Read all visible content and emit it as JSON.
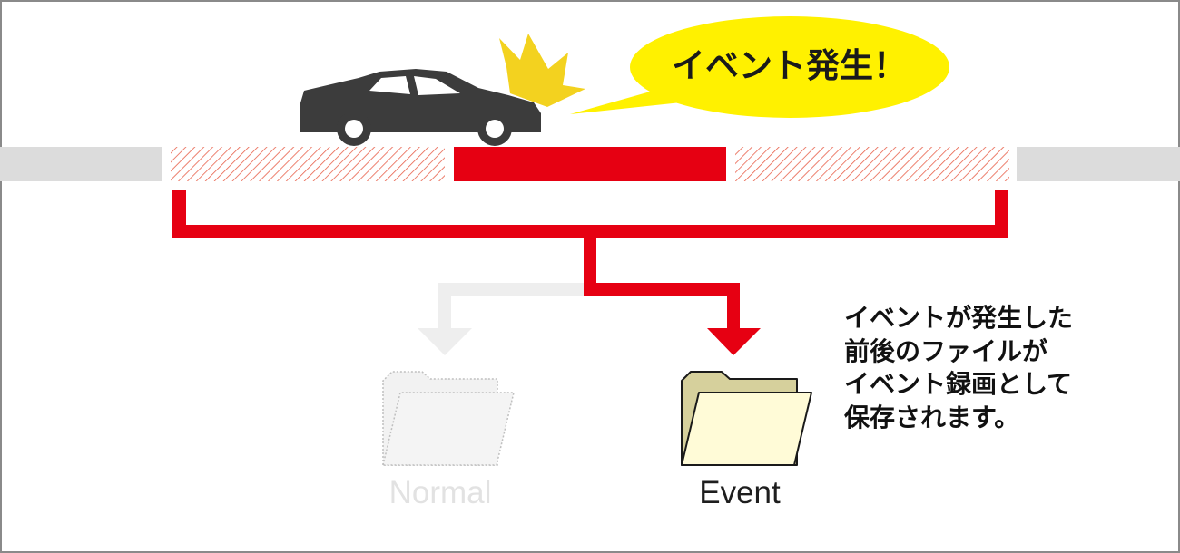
{
  "bubble": {
    "text": "イベント発生！"
  },
  "description": {
    "lines": [
      "イベントが発生した",
      "前後のファイルが",
      "イベント録画として",
      "保存されます。"
    ]
  },
  "folders": {
    "normal": {
      "label": "Normal",
      "icon": "folder-icon-faded"
    },
    "event": {
      "label": "Event",
      "icon": "folder-icon"
    }
  },
  "colors": {
    "accent_red": "#e60012",
    "track_gray": "#dcdcdc",
    "bubble_yellow": "#fff100",
    "burst_yellow": "#f3d21f",
    "car_dark": "#3c3c3c",
    "folder_back": "#d6d09c",
    "folder_front": "#fffbd7",
    "faded": "#eeeeee"
  }
}
